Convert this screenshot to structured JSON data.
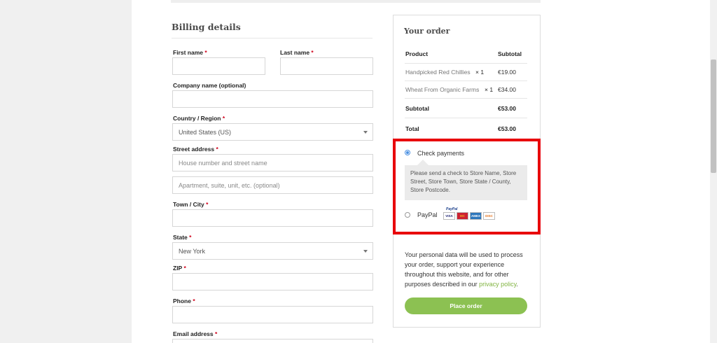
{
  "billing": {
    "title": "Billing details",
    "first_name_label": "First name",
    "last_name_label": "Last name",
    "company_label": "Company name (optional)",
    "country_label": "Country / Region",
    "country_value": "United States (US)",
    "street_label": "Street address",
    "street1_placeholder": "House number and street name",
    "street2_placeholder": "Apartment, suite, unit, etc. (optional)",
    "city_label": "Town / City",
    "state_label": "State",
    "state_value": "New York",
    "zip_label": "ZIP",
    "phone_label": "Phone",
    "email_label": "Email address",
    "required_mark": "*"
  },
  "order": {
    "title": "Your order",
    "col_product": "Product",
    "col_subtotal": "Subtotal",
    "items": [
      {
        "name": "Handpicked Red Chillies",
        "qty": "× 1",
        "price": "€19.00"
      },
      {
        "name": "Wheat From Organic Farms",
        "qty": "× 1",
        "price": "€34.00"
      }
    ],
    "subtotal_label": "Subtotal",
    "subtotal_value": "€53.00",
    "total_label": "Total",
    "total_value": "€53.00"
  },
  "payment": {
    "check_label": "Check payments",
    "check_description": "Please send a check to Store Name, Store Street, Store Town, Store State / County, Store Postcode.",
    "paypal_label": "PayPal",
    "paypal_mini": "PayPal",
    "card_visa": "VISA",
    "card_mc": "MC",
    "card_amex": "AMEX",
    "card_discover": "DISC",
    "selected": "check",
    "highlight_color": "#e8000b"
  },
  "privacy": {
    "text": "Your personal data will be used to process your order, support your experience throughout this website, and for other purposes described in our ",
    "link": "privacy policy",
    "end": "."
  },
  "place_order_label": "Place order",
  "accent_color": "#8cc152"
}
